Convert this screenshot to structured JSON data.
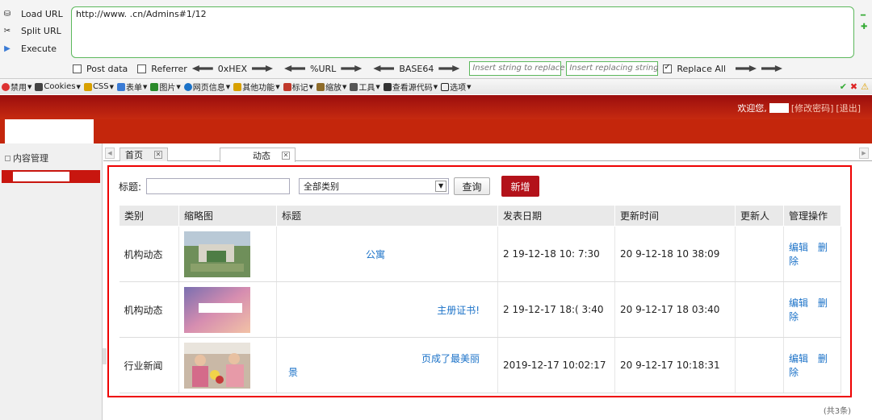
{
  "hackbar": {
    "load_url": "Load URL",
    "split_url": "Split URL",
    "execute": "Execute",
    "url_value": "http://www.                  .cn/Admins#1/12",
    "post_data": "Post data",
    "referrer": "Referrer",
    "hex": "0xHEX",
    "url_enc": "%URL",
    "base64": "BASE64",
    "insert_placeholder": "Insert string to replace",
    "replacing_placeholder": "Insert replacing string",
    "replace_all": "Replace All"
  },
  "toolbar": {
    "items": [
      "禁用",
      "Cookies",
      "CSS",
      "表单",
      "图片",
      "网页信息",
      "其他功能",
      "标记",
      "缩放",
      "工具",
      "查看源代码",
      "选项"
    ],
    "colors": [
      "#d33",
      "#444",
      "#d8a000",
      "#3a7bd5",
      "#2a8a2a",
      "#1b72c8",
      "#d8a000",
      "#c0392b",
      "#8e6c2a",
      "#555",
      "#333",
      "#222"
    ]
  },
  "header": {
    "welcome": "欢迎您,",
    "change_pwd": "[修改密码]",
    "logout": "[退出]"
  },
  "sidebar": {
    "section": "内容管理"
  },
  "tabs": [
    {
      "label": "首页"
    },
    {
      "label": "动态"
    }
  ],
  "filter": {
    "title_label": "标题:",
    "category": "全部类别",
    "query": "查询",
    "add": "新增"
  },
  "table": {
    "headers": [
      "类别",
      "缩略图",
      "标题",
      "发表日期",
      "更新时间",
      "更新人",
      "管理操作"
    ],
    "rows": [
      {
        "category": "机构动态",
        "title": "公寓",
        "date": "2 19-12-18 10: 7:30",
        "updated": "20 9-12-18 10 38:09",
        "edit": "编辑",
        "delete": "删除"
      },
      {
        "category": "机构动态",
        "title": "主册证书!",
        "date": "2 19-12-17 18:( 3:40",
        "updated": "20 9-12-17 18 03:40",
        "edit": "编辑",
        "delete": "删除"
      },
      {
        "category": "行业新闻",
        "title": "页成了最美丽",
        "title2": "景",
        "date": "2019-12-17 10:02:17",
        "updated": "20 9-12-17 10:18:31",
        "edit": "编辑",
        "delete": "删除"
      }
    ],
    "count": "(共3条)"
  }
}
